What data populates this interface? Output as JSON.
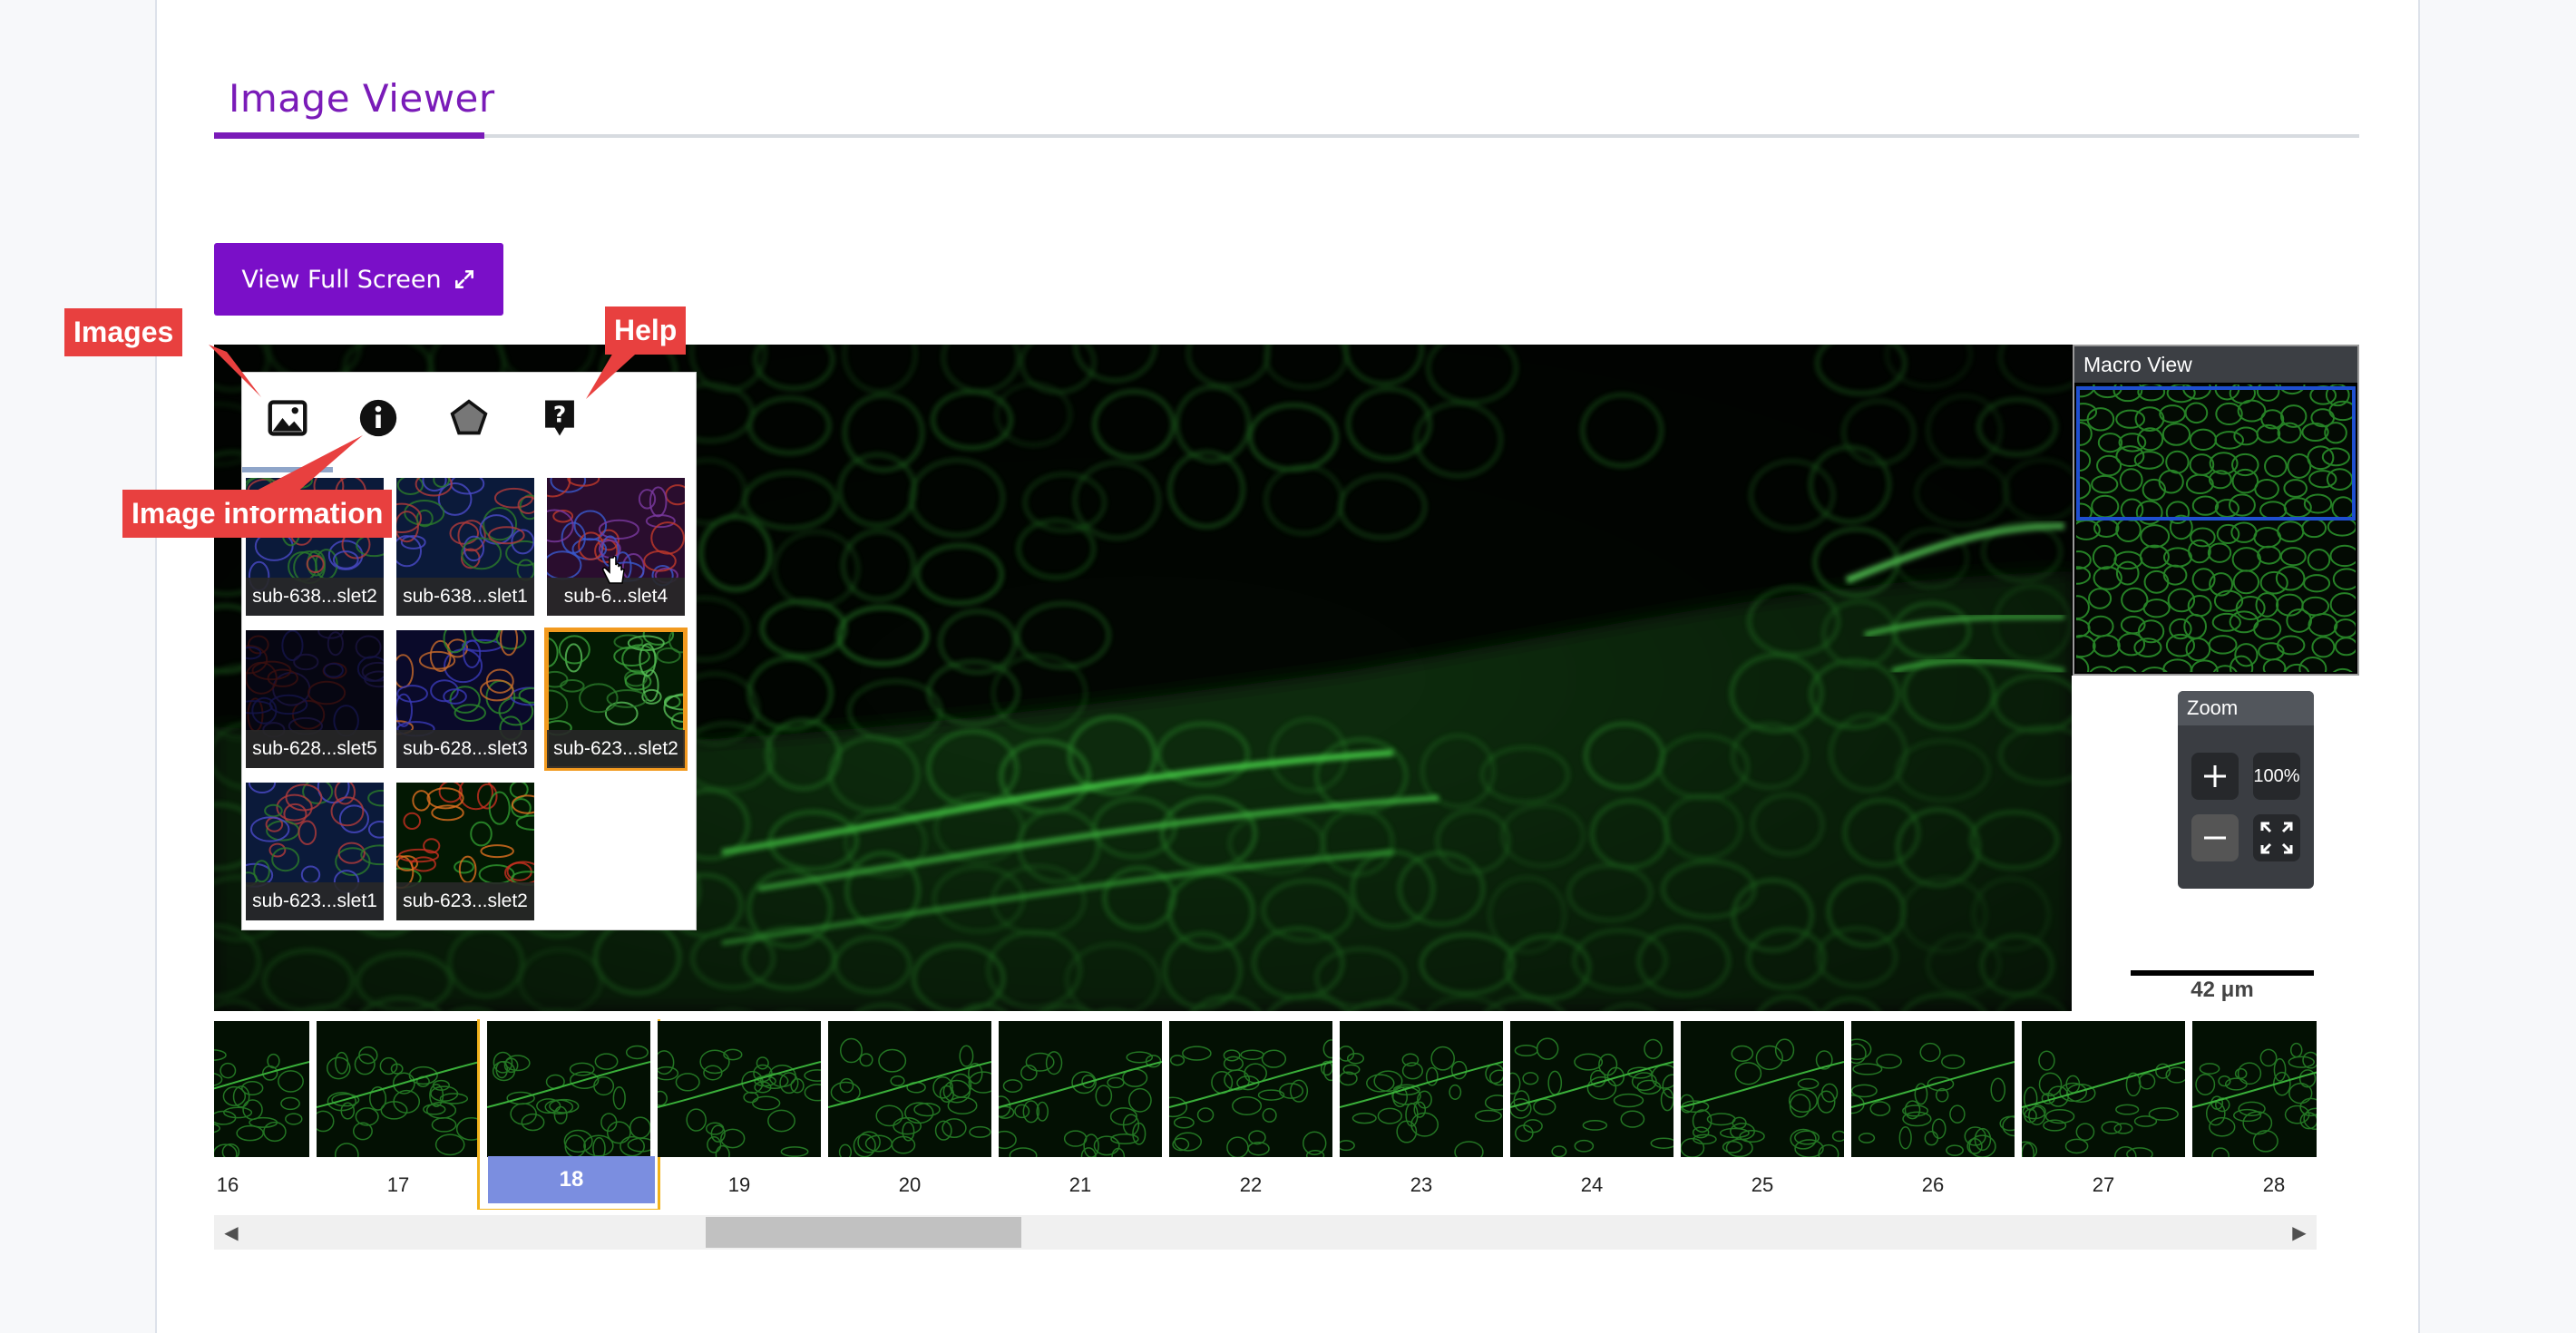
{
  "page": {
    "title": "Image Viewer"
  },
  "toolbar": {
    "fullscreen_label": "View Full Screen",
    "fullscreen_icon": "expand-arrows-icon"
  },
  "callouts": {
    "images": "Images",
    "help": "Help",
    "info": "Image information"
  },
  "panel": {
    "tabs": [
      {
        "name": "images-tab",
        "icon": "image-icon"
      },
      {
        "name": "info-tab",
        "icon": "info-circle-icon"
      },
      {
        "name": "annotations-tab",
        "icon": "pentagon-icon"
      },
      {
        "name": "help-tab",
        "icon": "help-question-icon"
      }
    ],
    "thumbnails": [
      {
        "label": "sub-638...slet2",
        "palette": "multi"
      },
      {
        "label": "sub-638...slet1",
        "palette": "multi"
      },
      {
        "label": "sub-6...slet4",
        "palette": "red"
      },
      {
        "label": "sub-628...slet5",
        "palette": "dark"
      },
      {
        "label": "sub-628...slet3",
        "palette": "blue"
      },
      {
        "label": "sub-623...slet2",
        "palette": "green",
        "selected": true
      },
      {
        "label": "sub-623...slet1",
        "palette": "multi"
      },
      {
        "label": "sub-623...slet2",
        "palette": "green-red"
      }
    ]
  },
  "macro": {
    "title": "Macro View"
  },
  "zoom": {
    "title": "Zoom",
    "level": "100%",
    "zoom_in_icon": "plus-icon",
    "zoom_out_icon": "minus-icon",
    "fit_icon": "fit-screen-icon"
  },
  "scale": {
    "label": "42 μm"
  },
  "filmstrip": {
    "selected": "18",
    "frames": [
      "16",
      "17",
      "18",
      "19",
      "20",
      "21",
      "22",
      "23",
      "24",
      "25",
      "26",
      "27",
      "28"
    ]
  },
  "scrollbar": {
    "thumb_fraction_start": 0.225,
    "thumb_fraction_size": 0.155
  },
  "colors": {
    "accent": "#7a0fc8",
    "callout": "#e8403f",
    "selected": "#f29a1f",
    "frame_selected": "#7b8ee0"
  }
}
